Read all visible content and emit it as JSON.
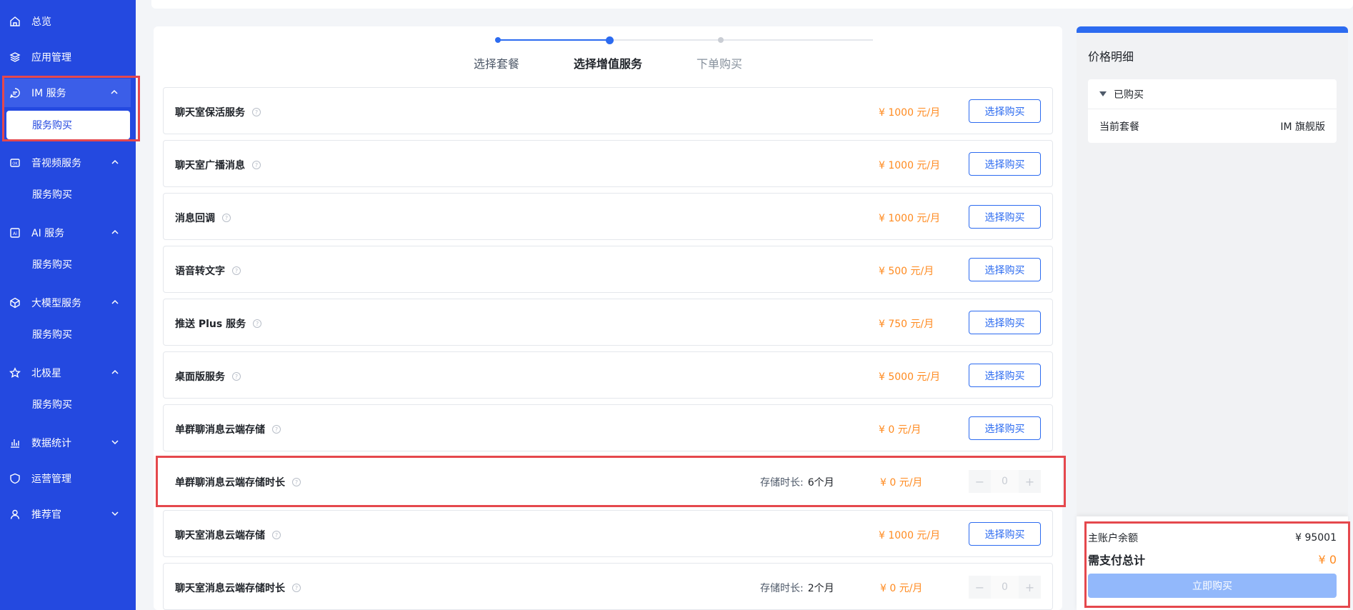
{
  "sidebar": {
    "overview": "总览",
    "app_mgmt": "应用管理",
    "im_service": "IM 服务",
    "im_purchase": "服务购买",
    "av_service": "音视频服务",
    "av_purchase": "服务购买",
    "ai_service": "AI 服务",
    "ai_purchase": "服务购买",
    "llm_service": "大模型服务",
    "llm_purchase": "服务购买",
    "polaris": "北极星",
    "polaris_purchase": "服务购买",
    "stats": "数据统计",
    "ops": "运营管理",
    "referral": "推荐官"
  },
  "steps": [
    "选择套餐",
    "选择增值服务",
    "下单购买"
  ],
  "services": [
    {
      "name": "聊天室保活服务",
      "price": "¥ 1000 元/月",
      "button": "选择购买"
    },
    {
      "name": "聊天室广播消息",
      "price": "¥ 1000 元/月",
      "button": "选择购买"
    },
    {
      "name": "消息回调",
      "price": "¥ 1000 元/月",
      "button": "选择购买"
    },
    {
      "name": "语音转文字",
      "price": "¥ 500 元/月",
      "button": "选择购买"
    },
    {
      "name": "推送 Plus 服务",
      "price": "¥ 750 元/月",
      "button": "选择购买"
    },
    {
      "name": "桌面版服务",
      "price": "¥ 5000 元/月",
      "button": "选择购买"
    },
    {
      "name": "单群聊消息云端存储",
      "price": "¥ 0 元/月",
      "button": "选择购买"
    },
    {
      "name": "单群聊消息云端存储时长",
      "duration_label": "存储时长:",
      "duration_value": "6个月",
      "price": "¥ 0 元/月",
      "stepper_value": "0"
    },
    {
      "name": "聊天室消息云端存储",
      "price": "¥ 1000 元/月",
      "button": "选择购买"
    },
    {
      "name": "聊天室消息云端存储时长",
      "duration_label": "存储时长:",
      "duration_value": "2个月",
      "price": "¥ 0 元/月",
      "stepper_value": "0"
    }
  ],
  "price_panel": {
    "title": "价格明细",
    "purchased_label": "已购买",
    "current_plan_label": "当前套餐",
    "current_plan_value": "IM 旗舰版"
  },
  "payment": {
    "balance_label": "主账户余额",
    "balance_value": "¥ 95001",
    "total_label": "需支付总计",
    "total_value": "¥ 0",
    "buy_button": "立即购买"
  },
  "colors": {
    "sidebar_bg": "#2449e0",
    "primary": "#2c6bf0",
    "price": "#ff8a1f",
    "highlight_box": "#e5484d"
  }
}
